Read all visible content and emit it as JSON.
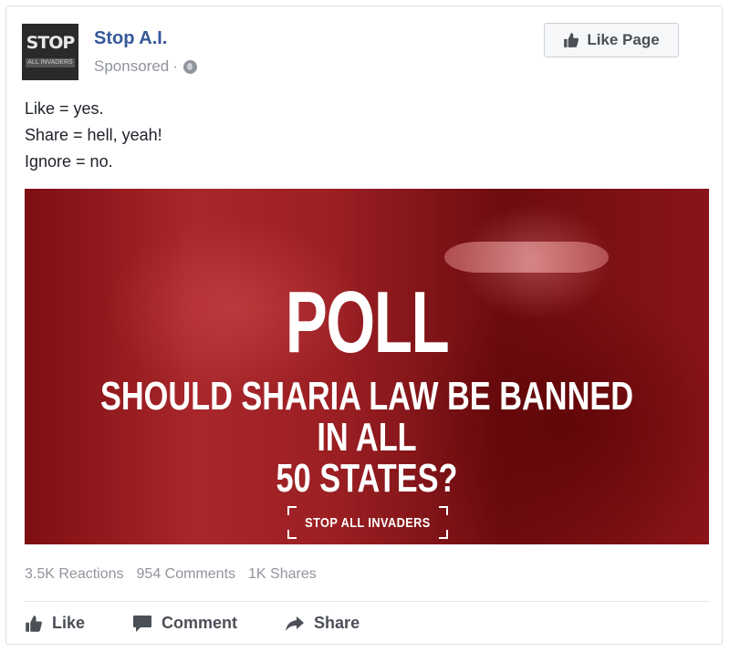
{
  "post": {
    "page_name": "Stop A.I.",
    "sponsored_label": "Sponsored",
    "separator": "·",
    "privacy_icon": "globe-icon",
    "avatar_text_top": "STOP",
    "avatar_text_bottom": "ALL INVADERS",
    "like_page_button": "Like Page",
    "body_lines": [
      "Like = yes.",
      "Share = hell, yeah!",
      "Ignore = no."
    ],
    "image": {
      "headline": "POLL",
      "question_line1": "SHOULD SHARIA LAW BE BANNED IN ALL",
      "question_line2": "50 STATES?",
      "brand": "STOP ALL INVADERS"
    },
    "stats": {
      "reactions": "3.5K Reactions",
      "comments": "954 Comments",
      "shares": "1K Shares"
    },
    "actions": {
      "like": "Like",
      "comment": "Comment",
      "share": "Share"
    }
  },
  "colors": {
    "link_blue": "#365899",
    "meta_gray": "#90949c",
    "image_red": "#9b1f23"
  }
}
